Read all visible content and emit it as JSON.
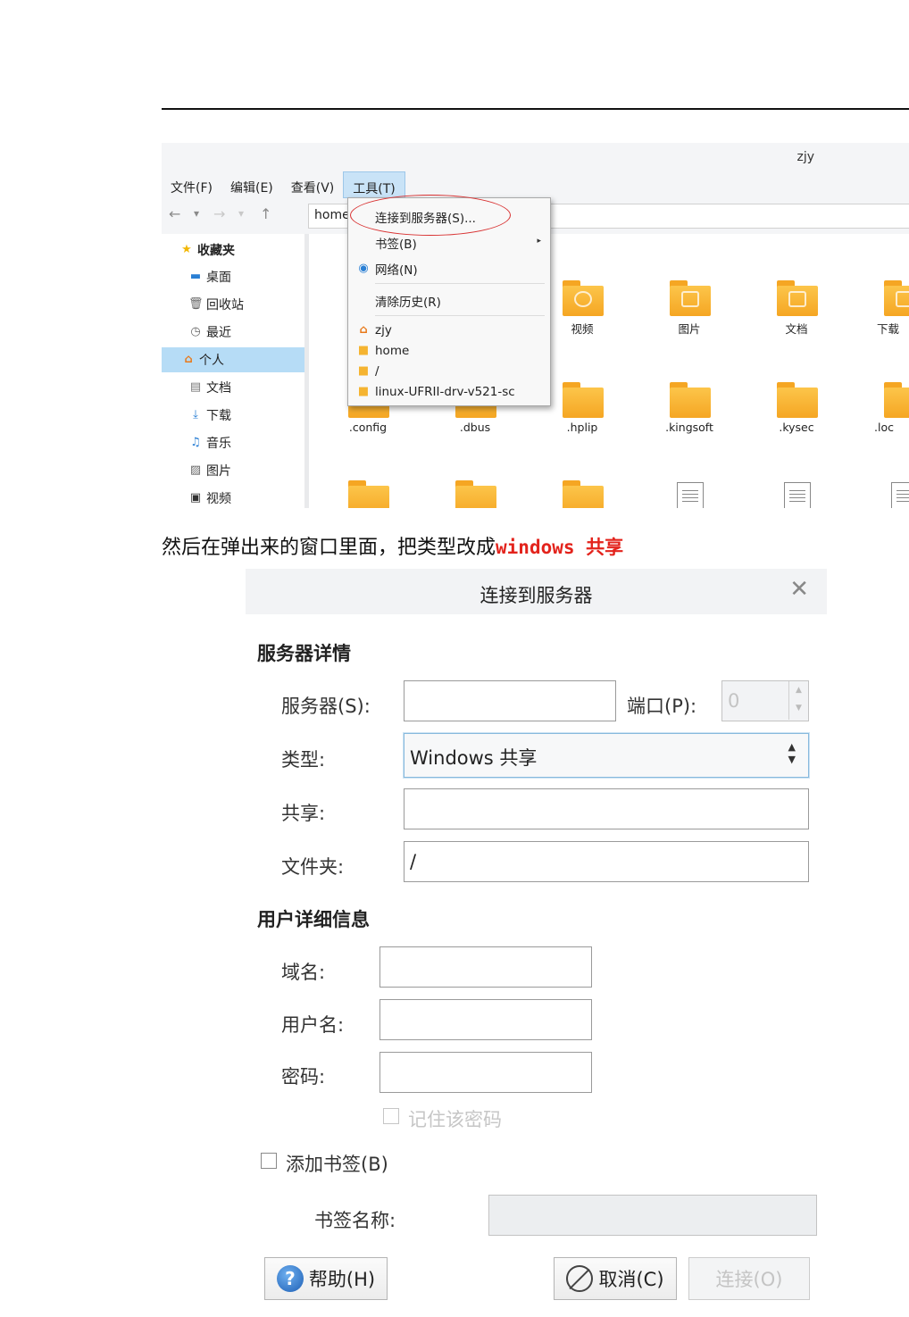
{
  "file_manager": {
    "window_title": "zjy",
    "menus": [
      "文件(F)",
      "编辑(E)",
      "查看(V)",
      "工具(T)"
    ],
    "path": "home",
    "nav": {
      "back": "←",
      "down": "▾",
      "forward": "→",
      "up": "↑"
    },
    "sidebar": {
      "favorites_label": "收藏夹",
      "items": [
        {
          "label": "桌面",
          "icon": "desktop-icon",
          "glyph": "▬"
        },
        {
          "label": "回收站",
          "icon": "trash-icon",
          "glyph": "🗑"
        },
        {
          "label": "最近",
          "icon": "clock-icon",
          "glyph": "◷"
        },
        {
          "label": "个人",
          "icon": "home-icon",
          "glyph": "⌂"
        },
        {
          "label": "文档",
          "icon": "document-icon",
          "glyph": "▤"
        },
        {
          "label": "下载",
          "icon": "download-icon",
          "glyph": "⤓"
        },
        {
          "label": "音乐",
          "icon": "music-icon",
          "glyph": "♫"
        },
        {
          "label": "图片",
          "icon": "picture-icon",
          "glyph": "▨"
        },
        {
          "label": "视频",
          "icon": "video-icon",
          "glyph": "▣"
        }
      ]
    },
    "content_row1": [
      "视频",
      "图片",
      "文档",
      "下载"
    ],
    "content_row2": [
      ".config",
      ".dbus",
      ".hplip",
      ".kingsoft",
      ".kysec",
      ".loc"
    ],
    "tools_menu": {
      "connect": "连接到服务器(S)...",
      "bookmarks": "书签(B)",
      "network": "网络(N)",
      "clear_history": "清除历史(R)",
      "places": [
        "zjy",
        "home",
        "/",
        "linux-UFRII-drv-v521-sc"
      ]
    }
  },
  "instruction": {
    "text": "然后在弹出来的窗口里面，把类型改成",
    "highlight": "windows 共享"
  },
  "dialog": {
    "title": "连接到服务器",
    "close_glyph": "✕",
    "server_section": "服务器详情",
    "server_label": "服务器(S):",
    "server_value": "",
    "port_label": "端口(P):",
    "port_value": "0",
    "type_label": "类型:",
    "type_value": "Windows 共享",
    "share_label": "共享:",
    "share_value": "",
    "folder_label": "文件夹:",
    "folder_value": "/",
    "user_section": "用户详细信息",
    "domain_label": "域名:",
    "username_label": "用户名:",
    "password_label": "密码:",
    "remember_label": "记住该密码",
    "add_bookmark_label": "添加书签(B)",
    "bookmark_name_label": "书签名称:",
    "help_button": "帮助(H)",
    "cancel_button": "取消(C)",
    "connect_button": "连接(O)",
    "help_glyph": "?"
  },
  "colors": {
    "highlight_red": "#e3231c",
    "menu_active": "#c9e3f7",
    "sidebar_active": "#b6dcf6",
    "folder": "#f5a623"
  }
}
